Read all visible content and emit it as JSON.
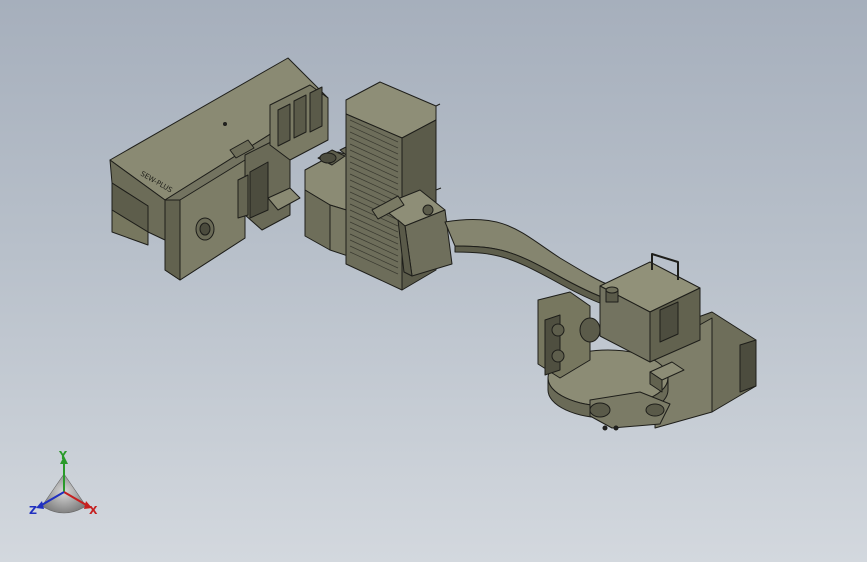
{
  "viewport": {
    "background_top": "#a6afbc",
    "background_bottom": "#d3d8de",
    "model_color": "#7f7f69"
  },
  "model": {
    "engraved_label": "SEW-PLUS"
  },
  "triad": {
    "x_label": "X",
    "y_label": "Y",
    "z_label": "Z",
    "x_color": "#c62020",
    "y_color": "#2a9a2a",
    "z_color": "#2030c0"
  }
}
